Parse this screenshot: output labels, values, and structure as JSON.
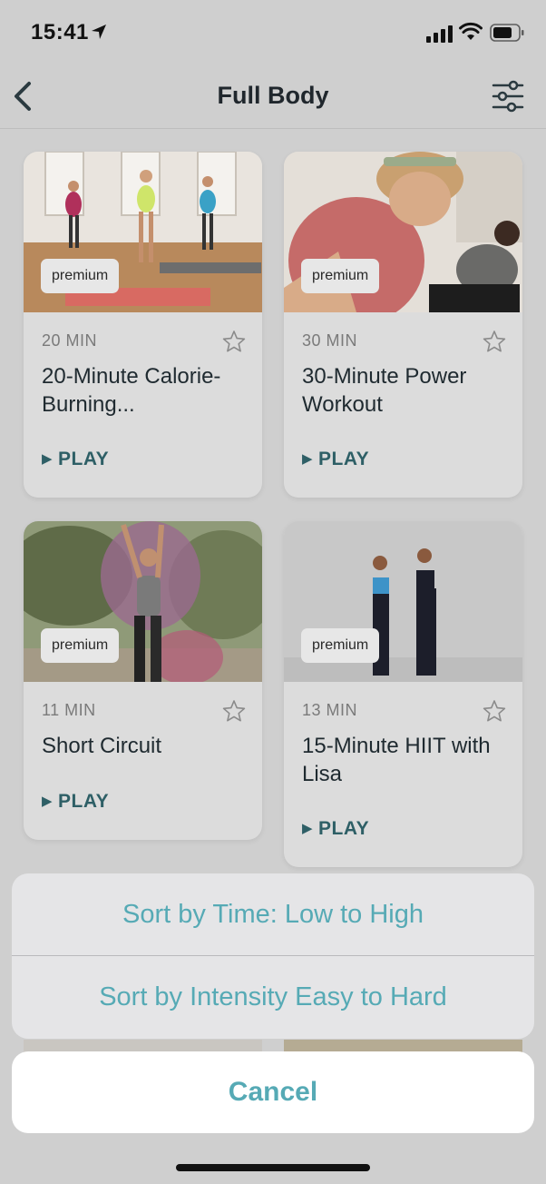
{
  "status_bar": {
    "time": "15:41"
  },
  "nav": {
    "title": "Full Body"
  },
  "cards": [
    {
      "badge": "premium",
      "duration": "20 MIN",
      "title": "20-Minute Calorie-Burning...",
      "play": "PLAY"
    },
    {
      "badge": "premium",
      "duration": "30 MIN",
      "title": "30-Minute Power Workout",
      "play": "PLAY"
    },
    {
      "badge": "premium",
      "duration": "11 MIN",
      "title": "Short Circuit",
      "play": "PLAY"
    },
    {
      "badge": "premium",
      "duration": "13 MIN",
      "title": "15-Minute HIIT with Lisa",
      "play": "PLAY"
    }
  ],
  "action_sheet": {
    "options": [
      "Sort by Time: Low to High",
      "Sort by Intensity Easy to Hard"
    ],
    "cancel": "Cancel"
  },
  "colors": {
    "accent": "#56aab5",
    "play": "#2e5f66",
    "overlay_bg": "#cfcfcf"
  },
  "icons": [
    "location-arrow-icon",
    "signal-icon",
    "wifi-icon",
    "battery-icon",
    "back-chevron-icon",
    "filter-sliders-icon",
    "star-icon",
    "play-icon"
  ]
}
